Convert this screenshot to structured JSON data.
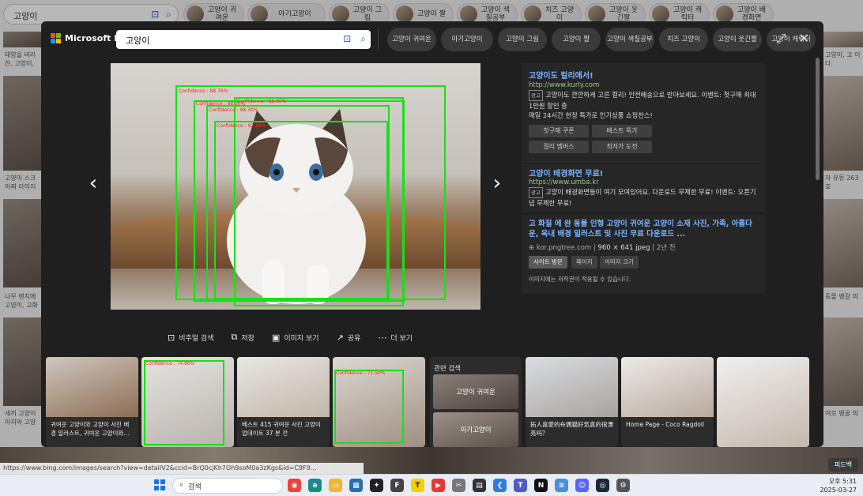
{
  "background": {
    "search_text": "고양이",
    "chips": [
      "고양이 귀여운",
      "아기고양이",
      "고양이 그림",
      "고양이 짤",
      "고양이 색칠공부",
      "치즈 고양이",
      "고양이 웃긴짤",
      "고양이 캐릭터",
      "고양이 배경화면"
    ],
    "left_captions": [
      "태양을 바라 찬, 고양이,",
      "고양이 스크 어쩌 라이지",
      "나무 벤치에 고양이, 고화",
      "새끼 고양이 아지와 고양"
    ],
    "right_captions": [
      "고양이, 고 이다.",
      "자 유튜 263호",
      "동물 벵갈 의",
      "여로 벵골 의"
    ],
    "status_url": "https://www.bing.com/images/search?view=detailV2&ccid=BrQ0cjKh7Oh9soM0a3zKgs&id=C9F9...",
    "feedback": "피드백"
  },
  "modal": {
    "logo_text": "Microsoft Bing",
    "search_value": "고양이",
    "chips": [
      "고양이 귀여운",
      "아기고양이",
      "고양이 그림",
      "고양이 짤",
      "고양이 색칠공부",
      "치즈 고양이",
      "고양이 웃긴짤",
      "고양이 캐릭터"
    ]
  },
  "detections": [
    {
      "label": "Confidence : 88.76%"
    },
    {
      "label": "Confidence : 88.30%"
    },
    {
      "label": "Confidence : 85.60%"
    },
    {
      "label": "Confidence : 98.30%"
    },
    {
      "label": "Confidence : 82.88%"
    }
  ],
  "ads": [
    {
      "title": "고양이도 컬리에서!",
      "url": "http://www.kurly.com",
      "badge": "광고",
      "desc": "고양이도 깐깐하게 고른 컬리! 안전배송으로 받아보세요. 이벤트: 첫구매 최대1만원 할인 중",
      "desc2": "매일 24시간 한정 특가로 인기상품 쇼핑찬스!",
      "buttons": [
        "첫구매 쿠폰",
        "베스트 특가",
        "컬리 멤버스",
        "최저가 도전"
      ]
    },
    {
      "title": "고양이 배경화면 무료!",
      "url": "https://www.umba.kr",
      "badge": "광고",
      "desc": "고양이 배경화면들이 여기 모여있어요. 다운로드 무제한 무료! 이벤트: 오픈기념 무제한 무료!"
    }
  ],
  "source": {
    "title": "고 화질 에 완 동물 인형 고양이 귀여운 고양이 소재 사진, 가족, 아름다운, 옥내 배경 일러스트 및 사진 무료 다운로드 ...",
    "domain": "kor.pngtree.com",
    "size": "960 × 641 jpeg",
    "age": "2년 전",
    "buttons": [
      "사이트 방문",
      "페이지",
      "이미지 크기"
    ],
    "note": "이미지에는 저작권이 적용될 수 있습니다."
  },
  "toolbar": [
    "비주얼 검색",
    "저장",
    "이미지 보기",
    "공유",
    "더 보기"
  ],
  "thumbs": [
    {
      "caption": "귀여운 고양이와 고양이 사진 배경 일러스트, 귀여운 고양이와..."
    },
    {
      "caption": "",
      "detection": "Confidence : 74.86%"
    },
    {
      "caption": "베스트 415 귀여운 사진 고양이 업데이트 37 분 전"
    },
    {
      "caption": "",
      "detection": "Confidence : 71.50%"
    },
    {
      "caption": "拓人喜愛的布偶猫好気真的很漂亮吗？"
    },
    {
      "caption": "Home Page - Coco Ragdoll"
    },
    {
      "caption": ""
    }
  ],
  "related": {
    "heading": "관련 검색",
    "items": [
      "고양이 귀여운",
      "아기고양이"
    ]
  },
  "taskbar": {
    "search_placeholder": "검색",
    "time": "오후 5:31",
    "date": "2025-03-27"
  },
  "colors": {
    "modal_bg": "#1f1f1f",
    "link_blue": "#7ab3ff",
    "detect_green": "#18e018",
    "detect_label_red": "#ff2020"
  }
}
